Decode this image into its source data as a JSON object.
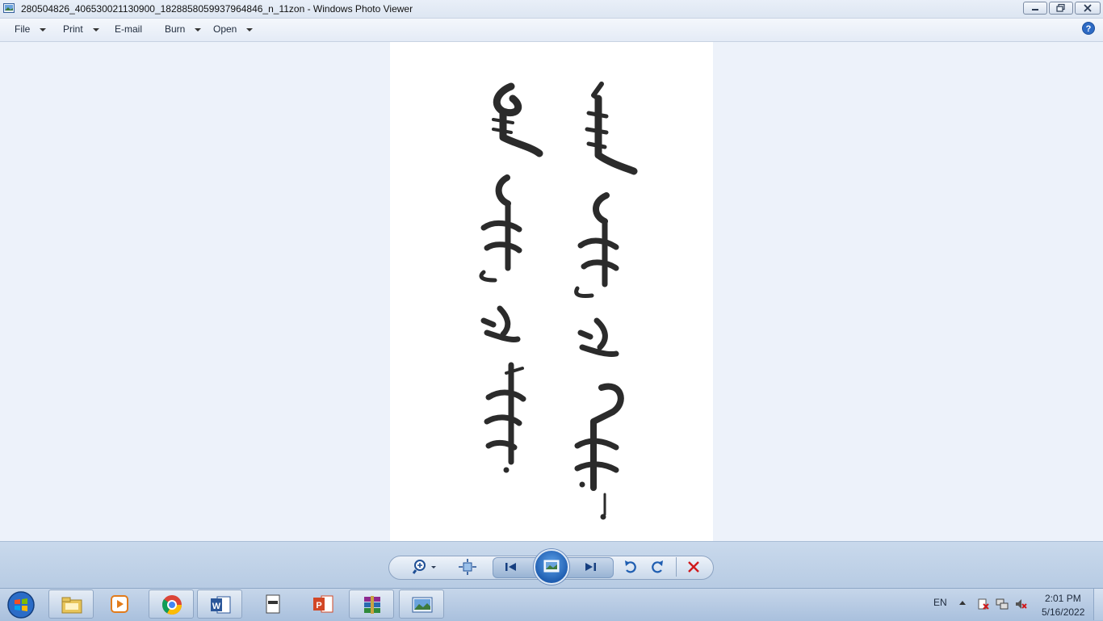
{
  "window": {
    "title": "280504826_406530021130900_1828858059937964846_n_11zon - Windows Photo Viewer",
    "icon": "photo-viewer-icon",
    "controls": [
      "minimize-icon",
      "maximize-icon",
      "close-icon"
    ]
  },
  "menu": {
    "items": [
      {
        "label": "File",
        "dropdown": true
      },
      {
        "label": "Print",
        "dropdown": true
      },
      {
        "label": "E-mail",
        "dropdown": false
      },
      {
        "label": "Burn",
        "dropdown": true
      },
      {
        "label": "Open",
        "dropdown": true
      }
    ],
    "help_icon": "help-icon"
  },
  "photo": {
    "content": "mongolian-script-calligraphy",
    "background": "#ffffff"
  },
  "controls": {
    "buttons": [
      "zoom-icon",
      "actual-size-icon",
      "previous-icon",
      "slideshow-icon",
      "next-icon",
      "rotate-counterclockwise-icon",
      "rotate-clockwise-icon",
      "delete-icon"
    ],
    "delete_color": "#d0191b"
  },
  "taskbar": {
    "apps": [
      "windows-explorer-icon",
      "media-player-icon",
      "chrome-icon",
      "word-icon",
      "notepad-icon",
      "powerpoint-icon",
      "winrar-icon",
      "photo-viewer-icon"
    ],
    "language": "EN",
    "time": "2:01 PM",
    "date": "5/16/2022",
    "tray_icons": [
      "action-center-icon",
      "network-icon",
      "volume-muted-icon"
    ]
  },
  "colors": {
    "accent": "#1f5eb1",
    "viewer_bg": "#edf2fa",
    "taskbar": "#b7cbe3"
  }
}
